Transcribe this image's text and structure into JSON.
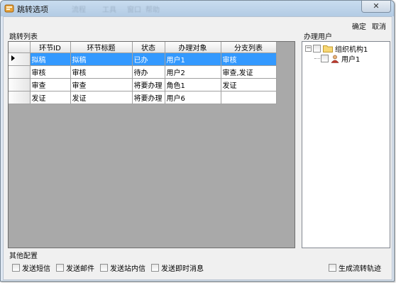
{
  "window": {
    "title": "跳转选项",
    "blurred_menu": [
      "流程",
      "工具",
      "窗口",
      "帮助"
    ],
    "close_label": "✕"
  },
  "toolbar": {
    "confirm_label": "确定",
    "cancel_label": "取消"
  },
  "left_panel": {
    "label": "跳转列表"
  },
  "right_panel": {
    "label": "办理用户"
  },
  "grid": {
    "columns": [
      "环节ID",
      "环节标题",
      "状态",
      "办理对象",
      "分支列表"
    ],
    "rows": [
      {
        "id": "拟稿",
        "title": "拟稿",
        "status": "已办",
        "handler": "用户1",
        "branches": "审核"
      },
      {
        "id": "审核",
        "title": "审核",
        "status": "待办",
        "handler": "用户2",
        "branches": "审查,发证"
      },
      {
        "id": "审查",
        "title": "审查",
        "status": "将要办理",
        "handler": "角色1",
        "branches": "发证"
      },
      {
        "id": "发证",
        "title": "发证",
        "status": "将要办理",
        "handler": "用户6",
        "branches": ""
      }
    ],
    "selected_row": 0
  },
  "tree": {
    "root": {
      "label": "组织机构1",
      "expander": "−"
    },
    "child": {
      "label": "用户1"
    }
  },
  "other_settings": {
    "label": "其他配置",
    "options": [
      "发送短信",
      "发送邮件",
      "发送站内信",
      "发送即时消息"
    ],
    "generate_trace": "生成流转轨迹"
  },
  "colors": {
    "selection": "#3399ff",
    "grid_background": "#a9a9a9"
  }
}
